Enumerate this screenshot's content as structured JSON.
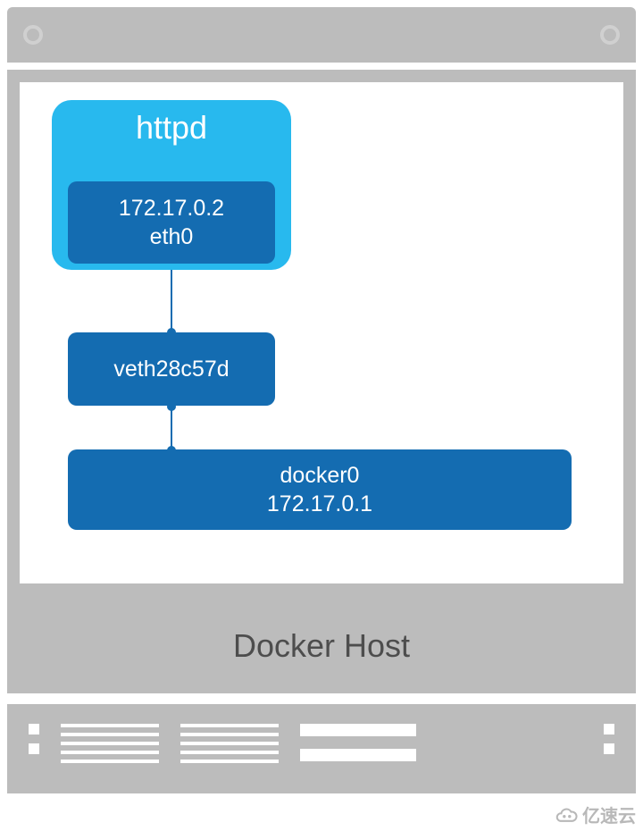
{
  "diagram": {
    "container": {
      "name": "httpd"
    },
    "eth": {
      "ip": "172.17.0.2",
      "iface": "eth0"
    },
    "veth": {
      "name": "veth28c57d"
    },
    "bridge": {
      "name": "docker0",
      "ip": "172.17.0.1"
    },
    "host_label": "Docker Host"
  },
  "watermark": "亿速云"
}
